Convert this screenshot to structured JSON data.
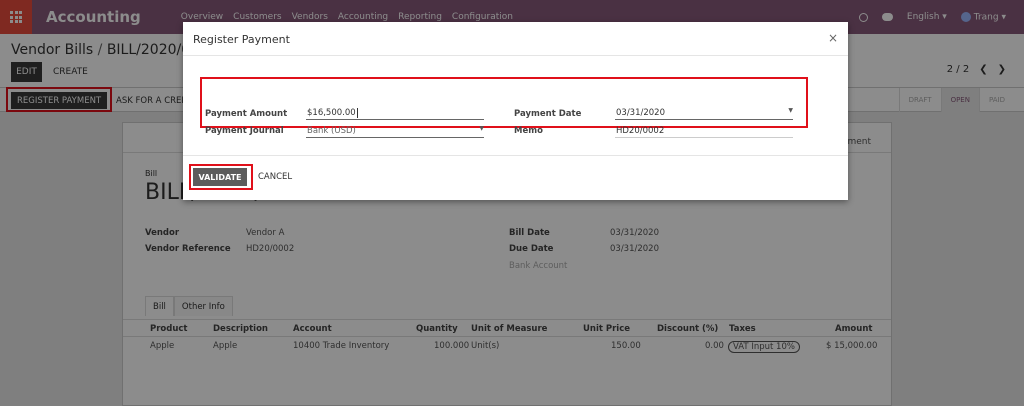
{
  "app": {
    "brand": "Accounting"
  },
  "menu": [
    "Overview",
    "Customers",
    "Vendors",
    "Accounting",
    "Reporting",
    "Configuration"
  ],
  "topbar": {
    "language": "English",
    "user": "Trang"
  },
  "breadcrumb": {
    "parent": "Vendor Bills",
    "current": "BILL/2020/0002"
  },
  "control": {
    "edit_label": "EDIT",
    "create_label": "CREATE",
    "pager": "2 / 2",
    "prev": "❮",
    "next": "❯"
  },
  "actions": {
    "register_payment": "REGISTER PAYMENT",
    "ask_credit": "ASK FOR A CREDIT NOTE"
  },
  "statuses": [
    "DRAFT",
    "OPEN",
    "PAID"
  ],
  "sheet": {
    "top_right": "1 Payment",
    "bill_label": "Bill",
    "bill_title": "BILL/2020/0002",
    "vendor_label": "Vendor",
    "vendor_value": "Vendor A",
    "vendor_ref_label": "Vendor Reference",
    "vendor_ref_value": "HD20/0002",
    "bill_date_label": "Bill Date",
    "bill_date_value": "03/31/2020",
    "due_date_label": "Due Date",
    "due_date_value": "03/31/2020",
    "bank_account_label": "Bank Account",
    "tabs": [
      "Bill",
      "Other Info"
    ],
    "columns": [
      "Product",
      "Description",
      "Account",
      "Quantity",
      "Unit of Measure",
      "Unit Price",
      "Discount (%)",
      "Taxes",
      "Amount"
    ],
    "rows": [
      {
        "product": "Apple",
        "description": "Apple",
        "account": "10400 Trade Inventory",
        "quantity": "100.000",
        "uom": "Unit(s)",
        "price": "150.00",
        "discount": "0.00",
        "tax": "VAT Input 10%",
        "amount": "$ 15,000.00"
      }
    ]
  },
  "modal": {
    "title": "Register Payment",
    "close": "×",
    "payment_amount_label": "Payment Amount",
    "payment_amount_value": "$16,500.00",
    "payment_journal_label": "Payment Journal",
    "payment_journal_value": "Bank (USD)",
    "payment_date_label": "Payment Date",
    "payment_date_value": "03/31/2020",
    "memo_label": "Memo",
    "memo_value": "HD20/0002",
    "validate_label": "VALIDATE",
    "cancel_label": "CANCEL"
  },
  "colors": {
    "topbar": "#875a7b",
    "apps": "#e74c3c",
    "highlight": "#e0101a"
  }
}
